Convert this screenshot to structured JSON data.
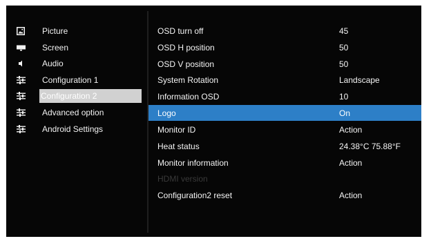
{
  "colors": {
    "background": "#060606",
    "highlight": "#2d7fc7",
    "selected_sidebar": "#d1d1d1",
    "disabled_text": "#3a3a3a",
    "text": "#f5f5f5"
  },
  "sidebar": {
    "items": [
      {
        "label": "Picture",
        "icon": "picture-icon"
      },
      {
        "label": "Screen",
        "icon": "screen-icon"
      },
      {
        "label": "Audio",
        "icon": "speaker-icon"
      },
      {
        "label": "Configuration 1",
        "icon": "sliders-icon"
      },
      {
        "label": "Configuration 2",
        "icon": "sliders-icon",
        "selected": true
      },
      {
        "label": "Advanced option",
        "icon": "sliders-icon"
      },
      {
        "label": "Android Settings",
        "icon": "sliders-icon"
      }
    ]
  },
  "main": {
    "rows": [
      {
        "name": "OSD turn off",
        "value": "45"
      },
      {
        "name": "OSD H position",
        "value": "50"
      },
      {
        "name": "OSD V position",
        "value": "50"
      },
      {
        "name": "System Rotation",
        "value": "Landscape"
      },
      {
        "name": "Information OSD",
        "value": "10"
      },
      {
        "name": "Logo",
        "value": "On",
        "highlighted": true
      },
      {
        "name": "Monitor ID",
        "value": "Action"
      },
      {
        "name": "Heat status",
        "value": "24.38°C 75.88°F"
      },
      {
        "name": "Monitor information",
        "value": "Action"
      },
      {
        "name": "HDMI version",
        "value": "",
        "disabled": true
      },
      {
        "name": "Configuration2 reset",
        "value": "Action"
      }
    ]
  }
}
